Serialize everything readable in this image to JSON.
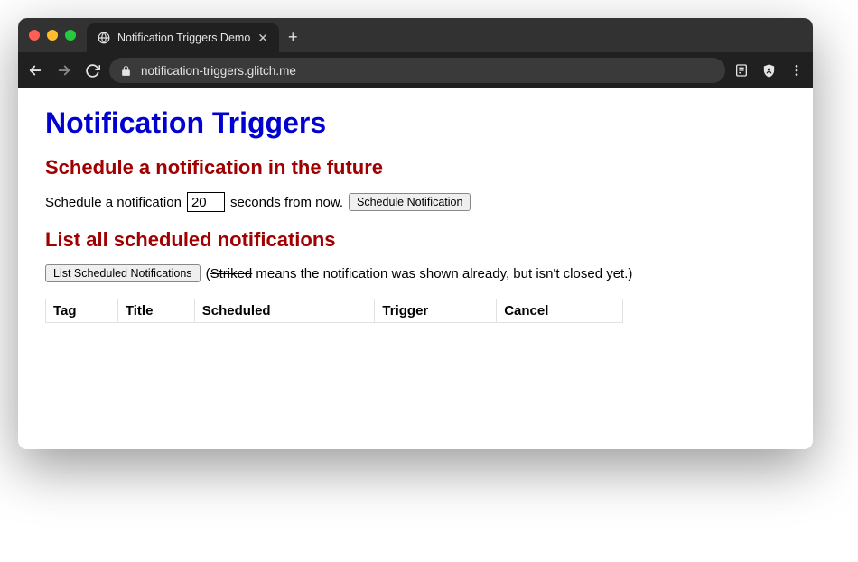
{
  "browser": {
    "tab_title": "Notification Triggers Demo",
    "url": "notification-triggers.glitch.me"
  },
  "page": {
    "h1": "Notification Triggers",
    "section1": {
      "heading": "Schedule a notification in the future",
      "text_before": "Schedule a notification",
      "seconds_value": "20",
      "text_after": "seconds from now.",
      "button": "Schedule Notification"
    },
    "section2": {
      "heading": "List all scheduled notifications",
      "button": "List Scheduled Notifications",
      "hint_prefix": "(",
      "hint_striked": "Striked",
      "hint_rest": " means the notification was shown already, but isn't closed yet.)",
      "columns": {
        "c1": "Tag",
        "c2": "Title",
        "c3": "Scheduled",
        "c4": "Trigger",
        "c5": "Cancel"
      }
    }
  }
}
